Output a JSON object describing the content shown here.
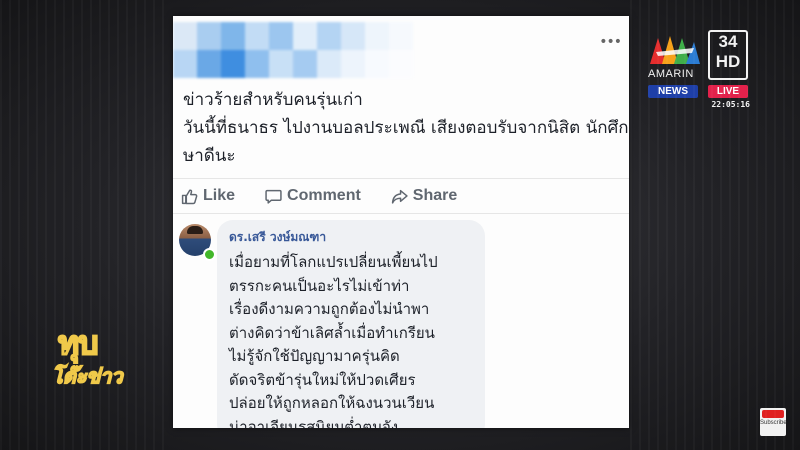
{
  "post": {
    "lines": [
      "ข่าวร้ายสำหรับคนรุ่นเก่า",
      "วันนี้ที่ธนาธร ไปงานบอลประเพณี เสียงตอบรับจากนิสิต นักศึก",
      "ษาดีนะ"
    ]
  },
  "actions": {
    "like_label": "Like",
    "comment_label": "Comment",
    "share_label": "Share"
  },
  "comment": {
    "author": "ดร.เสรี วงษ์มณฑา",
    "lines": [
      "เมื่อยามที่โลกแปรเปลี่ยนเพี้ยนไป",
      "ตรรกะคนเป็นอะไรไม่เข้าท่า",
      "เรื่องดีงามความถูกต้องไม่นำพา",
      "ต่างคิดว่าข้าเลิศล้ำเมื่อทำเกรียน",
      "ไม่รู้จักใช้ปัญญามาครุ่นคิด",
      "ดัดจริตข้ารุ่นใหม่ให้ปวดเศียร",
      "ปล่อยให้ถูกหลอกให้ฉงนวนเวียน",
      "น่าอาเจียนรสนิยมต่ำตมจัง"
    ]
  },
  "channel": {
    "brand": "AMARIN",
    "news_label": "NEWS",
    "channel_number": "34",
    "hd_label": "HD",
    "live_label": "LIVE",
    "time": "22:05:16"
  },
  "program": {
    "line1": "ทุบ",
    "line2": "โต๊ะข่าว"
  },
  "subscribe_logo": {
    "text": "Subscribe"
  },
  "colors": {
    "link_blue": "#385898",
    "action_gray": "#606770",
    "news_blue": "#1e3fa8",
    "live_red": "#e3214b",
    "online_green": "#42b72a"
  }
}
